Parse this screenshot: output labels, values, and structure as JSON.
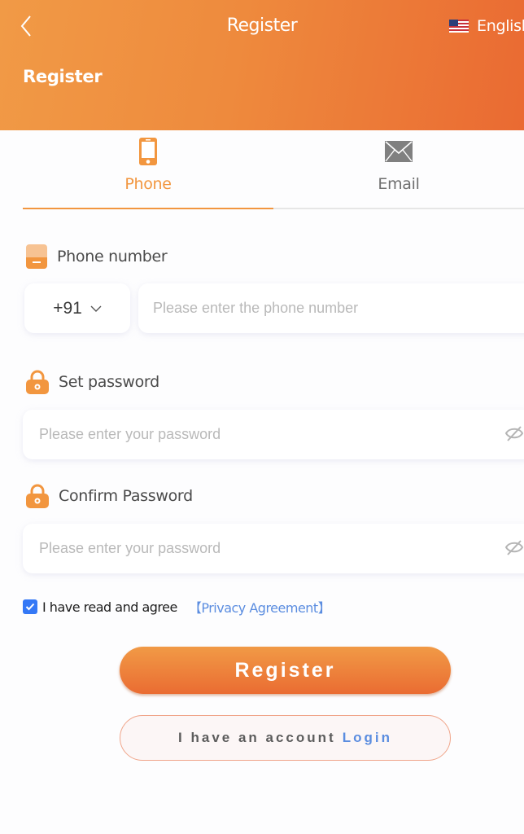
{
  "header": {
    "nav_title": "Register",
    "heading": "Register",
    "back_icon": "chevron-left-icon",
    "language": {
      "label": "English",
      "flag_icon": "us-flag-icon"
    },
    "gradient_start": "#f19a46",
    "gradient_end": "#ea6a32"
  },
  "tabs": [
    {
      "label": "Phone",
      "icon": "smartphone-icon",
      "active": true
    },
    {
      "label": "Email",
      "icon": "envelope-icon",
      "active": false
    }
  ],
  "form": {
    "phone": {
      "label": "Phone number",
      "icon": "phone-book-icon",
      "country_code": "+91",
      "placeholder": "Please enter the phone number",
      "value": ""
    },
    "password": {
      "label": "Set password",
      "icon": "lock-icon",
      "placeholder": "Please enter your password",
      "value": "",
      "toggle_icon": "eye-off-icon"
    },
    "confirm_password": {
      "label": "Confirm Password",
      "icon": "lock-icon",
      "placeholder": "Please enter your password",
      "value": "",
      "toggle_icon": "eye-off-icon"
    },
    "agreement": {
      "checked": true,
      "text": "I have read and agree",
      "link_text": "【Privacy Agreement】"
    }
  },
  "actions": {
    "register_label": "Register",
    "login_prefix": "I have an account",
    "login_link": "Login"
  },
  "colors": {
    "accent": "#f2963f",
    "link": "#5b8de0",
    "checkbox": "#3478f6"
  }
}
